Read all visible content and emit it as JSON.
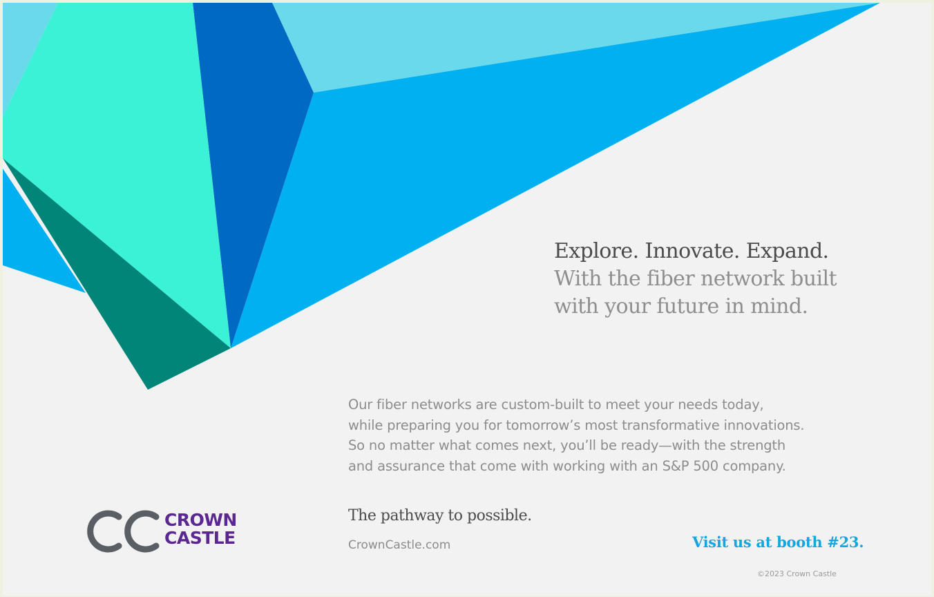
{
  "headline": {
    "line1": "Explore. Innovate. Expand.",
    "line2": "With the fiber network built",
    "line3": "with your future in mind."
  },
  "body_copy": [
    "Our fiber networks are custom-built to meet your needs today,",
    "while preparing you for tomorrow’s most transformative innovations.",
    "So no matter what comes next, you’ll be ready—with the strength",
    "and assurance that come with working with an S&P 500 company."
  ],
  "tagline": "The pathway to possible.",
  "website": "CrownCastle.com",
  "booth": "Visit us at booth #23.",
  "copyright": "©2023 Crown Castle",
  "logo": {
    "line1": "CROWN",
    "line2": "CASTLE",
    "icon": "crown-castle-cc-mark-icon"
  },
  "colors": {
    "background": "#f2f2f2",
    "brand_purple": "#5b2891",
    "logo_gray": "#5a5f66",
    "booth_blue": "#15a6df",
    "light_cyan": "#6ad9eb",
    "sky_blue": "#00b0f0",
    "royal_blue": "#0069c4",
    "mint": "#3cf2d6",
    "teal": "#008578"
  }
}
